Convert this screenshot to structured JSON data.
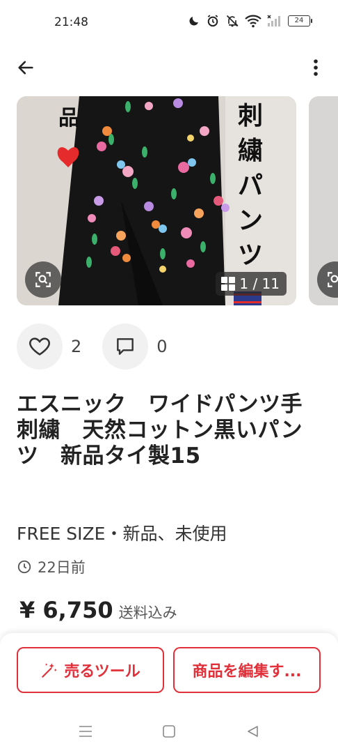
{
  "status_bar": {
    "time": "21:48",
    "battery": "24",
    "icons": [
      "moon-icon",
      "alarm-icon",
      "mute-icon",
      "wifi-icon",
      "signal-icon",
      "battery-icon"
    ]
  },
  "app_bar": {
    "back_icon": "arrow-left-icon",
    "more_icon": "more-vertical-icon"
  },
  "gallery": {
    "counter": "1 / 11",
    "image_text_left": "品",
    "image_text_right": "刺繍パンツ",
    "zoom_icon": "zoom-search-icon"
  },
  "engagement": {
    "likes": "2",
    "comments": "0"
  },
  "listing": {
    "title": "エスニック　ワイドパンツ手刺繍　天然コットン黒いパンツ　新品タイ製15",
    "condition": "FREE SIZE・新品、未使用",
    "posted": "22日前",
    "price": "¥ 6,750",
    "shipping": "送料込み"
  },
  "bottom_bar": {
    "sell_tool": "売るツール",
    "edit_item": "商品を編集す..."
  },
  "colors": {
    "accent": "#e0303a",
    "text": "#222222",
    "muted": "#555555"
  }
}
